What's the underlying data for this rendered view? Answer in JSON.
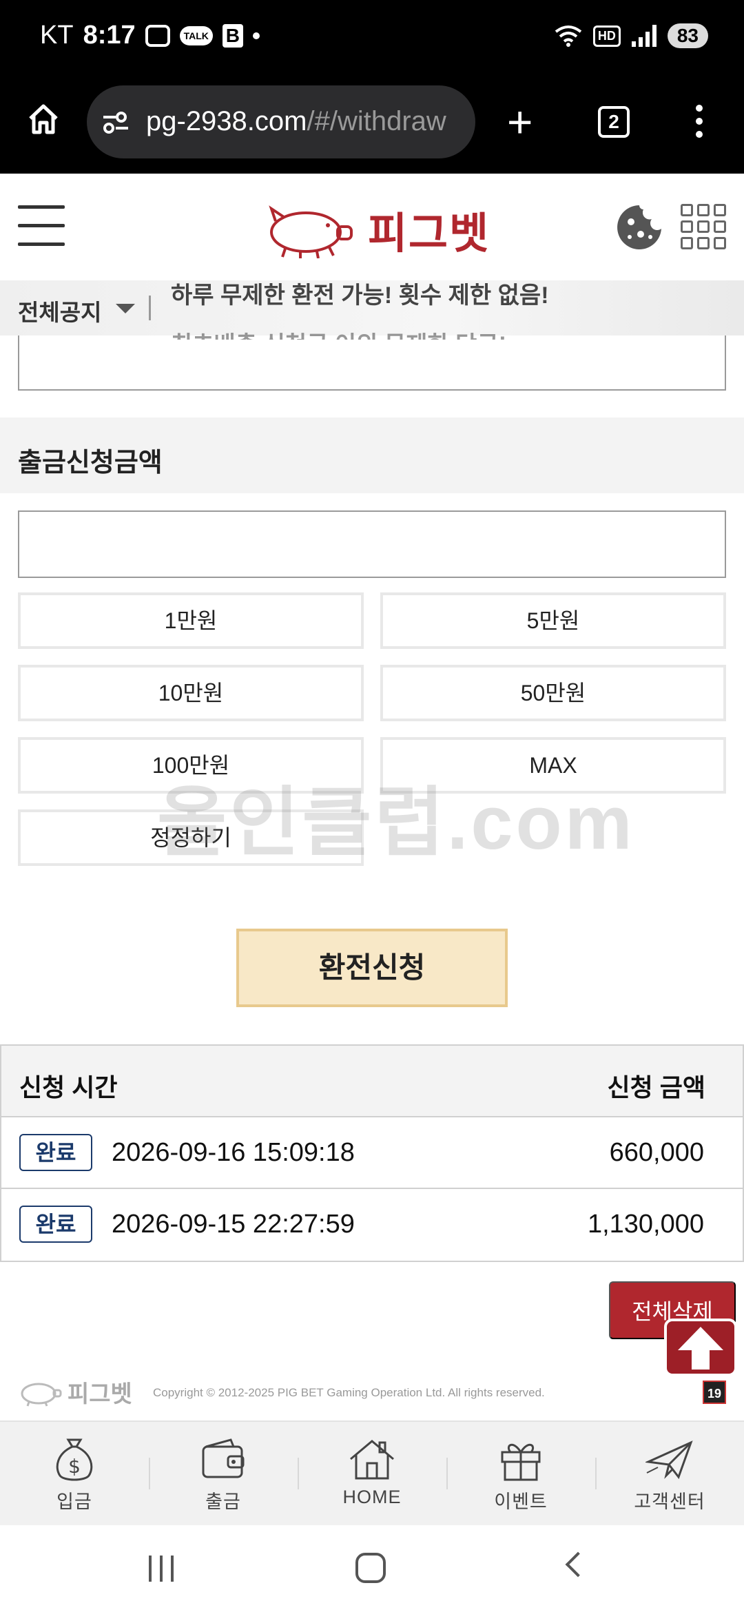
{
  "status_bar": {
    "carrier": "KT",
    "time": "8:17",
    "talk_badge": "TALK",
    "b_badge": "B",
    "network": "HD",
    "battery": "83"
  },
  "browser": {
    "url_domain": "pg-2938.com",
    "url_path": "/#/withdraw",
    "tab_count": "2"
  },
  "site": {
    "logo_text": "피그벳"
  },
  "notice": {
    "label": "전체공지",
    "text_line1": "하루 무제한 환전 가능! 횟수 제한 없음!",
    "text_line2": "최초배출 신청금 이외 문제한 당근!"
  },
  "withdraw": {
    "section_title": "출금신청금액",
    "amount_value": "",
    "amount_buttons": [
      "1만원",
      "5만원",
      "10만원",
      "50만원",
      "100만원",
      "MAX",
      "정정하기"
    ],
    "submit_label": "환전신청",
    "watermark": "올인클럽.com"
  },
  "history": {
    "col_time": "신청 시간",
    "col_amount": "신청 금액",
    "rows": [
      {
        "status": "완료",
        "time": "2026-09-16 15:09:18",
        "amount": "660,000"
      },
      {
        "status": "완료",
        "time": "2026-09-15 22:27:59",
        "amount": "1,130,000"
      }
    ],
    "delete_all": "전체삭제"
  },
  "footer": {
    "logo_text": "피그벳",
    "copyright": "Copyright © 2012-2025 PIG BET Gaming Operation Ltd. All rights reserved.",
    "age_badge": "19"
  },
  "bottom_nav": [
    {
      "label": "입금",
      "icon": "money-bag-icon"
    },
    {
      "label": "출금",
      "icon": "wallet-icon"
    },
    {
      "label": "HOME",
      "icon": "house-icon"
    },
    {
      "label": "이벤트",
      "icon": "gift-icon"
    },
    {
      "label": "고객센터",
      "icon": "paper-plane-icon"
    }
  ],
  "colors": {
    "brand": "#b0272e",
    "submit_bg": "#f8e8c7",
    "badge": "#1b3a6b"
  }
}
